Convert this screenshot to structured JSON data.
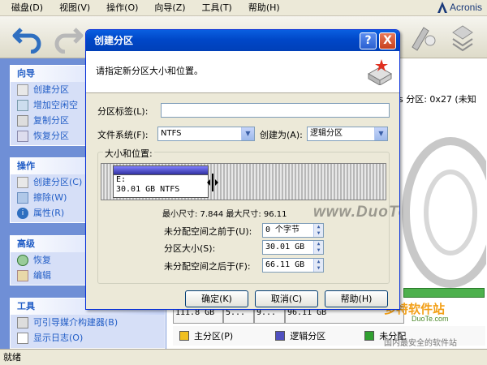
{
  "menubar": {
    "items": [
      "磁盘(D)",
      "视图(V)",
      "操作(O)",
      "向导(Z)",
      "工具(T)",
      "帮助(H)"
    ],
    "logo": "Acronis"
  },
  "sidebar": {
    "sections": [
      {
        "title": "向导",
        "items": [
          "创建分区",
          "增加空闲空",
          "复制分区",
          "恢复分区"
        ]
      },
      {
        "title": "操作",
        "items": [
          "创建分区(C)",
          "擦除(W)",
          "属性(R)"
        ]
      },
      {
        "title": "高级",
        "items": [
          "恢复",
          "编辑"
        ]
      },
      {
        "title": "工具",
        "items": [
          "可引导媒介构建器(B)",
          "显示日志(O)"
        ]
      }
    ]
  },
  "background": {
    "partition_hint": "s 分区: 0x27 (未知",
    "disk_size": "111.8 GB",
    "cell_small_1": "5...",
    "cell_small_2": "9...",
    "cell_size_2": "96.11 GB",
    "legend": {
      "primary": "主分区(P)",
      "logical": "逻辑分区",
      "unallocated": "未分配",
      "colors": {
        "primary": "#f0c020",
        "logical": "#5050c0",
        "unallocated": "#30a030"
      }
    },
    "watermark_right": "多特软件站",
    "watermark_right_sub": "国内最安全的软件站",
    "watermark_right_url": "DuoTe.com"
  },
  "status": {
    "text": "就绪"
  },
  "dialog": {
    "title": "创建分区",
    "help_btn": "?",
    "close_btn": "X",
    "instruction": "请指定新分区大小和位置。",
    "label_field": {
      "label": "分区标签(L):",
      "value": ""
    },
    "fs": {
      "label": "文件系统(F):",
      "value": "NTFS"
    },
    "create_as": {
      "label": "创建为(A):",
      "value": "逻辑分区"
    },
    "group_title": "大小和位置:",
    "partition_bar": {
      "drive": "E:",
      "info": "30.01 GB  NTFS",
      "fill_fraction": 0.35
    },
    "size_info": "最小尺寸: 7.844 最大尺寸: 96.11",
    "before": {
      "label": "未分配空间之前于(U):",
      "value": "0 个字节"
    },
    "size": {
      "label": "分区大小(S):",
      "value": "30.01 GB"
    },
    "after": {
      "label": "未分配空间之后于(F):",
      "value": "66.11 GB"
    },
    "buttons": {
      "ok": "确定(K)",
      "cancel": "取消(C)",
      "help": "帮助(H)"
    }
  },
  "watermark": "www.DuoTe.com",
  "accent": "#0047c8"
}
